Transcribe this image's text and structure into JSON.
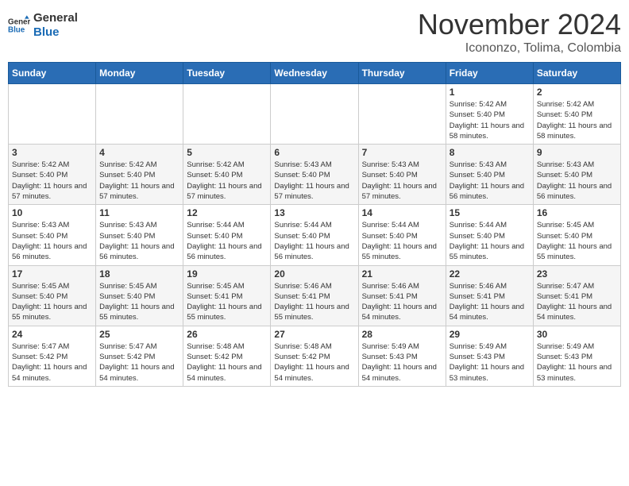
{
  "header": {
    "logo_general": "General",
    "logo_blue": "Blue",
    "month_title": "November 2024",
    "location": "Icononzo, Tolima, Colombia"
  },
  "weekdays": [
    "Sunday",
    "Monday",
    "Tuesday",
    "Wednesday",
    "Thursday",
    "Friday",
    "Saturday"
  ],
  "weeks": [
    [
      {
        "day": "",
        "detail": ""
      },
      {
        "day": "",
        "detail": ""
      },
      {
        "day": "",
        "detail": ""
      },
      {
        "day": "",
        "detail": ""
      },
      {
        "day": "",
        "detail": ""
      },
      {
        "day": "1",
        "detail": "Sunrise: 5:42 AM\nSunset: 5:40 PM\nDaylight: 11 hours and 58 minutes."
      },
      {
        "day": "2",
        "detail": "Sunrise: 5:42 AM\nSunset: 5:40 PM\nDaylight: 11 hours and 58 minutes."
      }
    ],
    [
      {
        "day": "3",
        "detail": "Sunrise: 5:42 AM\nSunset: 5:40 PM\nDaylight: 11 hours and 57 minutes."
      },
      {
        "day": "4",
        "detail": "Sunrise: 5:42 AM\nSunset: 5:40 PM\nDaylight: 11 hours and 57 minutes."
      },
      {
        "day": "5",
        "detail": "Sunrise: 5:42 AM\nSunset: 5:40 PM\nDaylight: 11 hours and 57 minutes."
      },
      {
        "day": "6",
        "detail": "Sunrise: 5:43 AM\nSunset: 5:40 PM\nDaylight: 11 hours and 57 minutes."
      },
      {
        "day": "7",
        "detail": "Sunrise: 5:43 AM\nSunset: 5:40 PM\nDaylight: 11 hours and 57 minutes."
      },
      {
        "day": "8",
        "detail": "Sunrise: 5:43 AM\nSunset: 5:40 PM\nDaylight: 11 hours and 56 minutes."
      },
      {
        "day": "9",
        "detail": "Sunrise: 5:43 AM\nSunset: 5:40 PM\nDaylight: 11 hours and 56 minutes."
      }
    ],
    [
      {
        "day": "10",
        "detail": "Sunrise: 5:43 AM\nSunset: 5:40 PM\nDaylight: 11 hours and 56 minutes."
      },
      {
        "day": "11",
        "detail": "Sunrise: 5:43 AM\nSunset: 5:40 PM\nDaylight: 11 hours and 56 minutes."
      },
      {
        "day": "12",
        "detail": "Sunrise: 5:44 AM\nSunset: 5:40 PM\nDaylight: 11 hours and 56 minutes."
      },
      {
        "day": "13",
        "detail": "Sunrise: 5:44 AM\nSunset: 5:40 PM\nDaylight: 11 hours and 56 minutes."
      },
      {
        "day": "14",
        "detail": "Sunrise: 5:44 AM\nSunset: 5:40 PM\nDaylight: 11 hours and 55 minutes."
      },
      {
        "day": "15",
        "detail": "Sunrise: 5:44 AM\nSunset: 5:40 PM\nDaylight: 11 hours and 55 minutes."
      },
      {
        "day": "16",
        "detail": "Sunrise: 5:45 AM\nSunset: 5:40 PM\nDaylight: 11 hours and 55 minutes."
      }
    ],
    [
      {
        "day": "17",
        "detail": "Sunrise: 5:45 AM\nSunset: 5:40 PM\nDaylight: 11 hours and 55 minutes."
      },
      {
        "day": "18",
        "detail": "Sunrise: 5:45 AM\nSunset: 5:40 PM\nDaylight: 11 hours and 55 minutes."
      },
      {
        "day": "19",
        "detail": "Sunrise: 5:45 AM\nSunset: 5:41 PM\nDaylight: 11 hours and 55 minutes."
      },
      {
        "day": "20",
        "detail": "Sunrise: 5:46 AM\nSunset: 5:41 PM\nDaylight: 11 hours and 55 minutes."
      },
      {
        "day": "21",
        "detail": "Sunrise: 5:46 AM\nSunset: 5:41 PM\nDaylight: 11 hours and 54 minutes."
      },
      {
        "day": "22",
        "detail": "Sunrise: 5:46 AM\nSunset: 5:41 PM\nDaylight: 11 hours and 54 minutes."
      },
      {
        "day": "23",
        "detail": "Sunrise: 5:47 AM\nSunset: 5:41 PM\nDaylight: 11 hours and 54 minutes."
      }
    ],
    [
      {
        "day": "24",
        "detail": "Sunrise: 5:47 AM\nSunset: 5:42 PM\nDaylight: 11 hours and 54 minutes."
      },
      {
        "day": "25",
        "detail": "Sunrise: 5:47 AM\nSunset: 5:42 PM\nDaylight: 11 hours and 54 minutes."
      },
      {
        "day": "26",
        "detail": "Sunrise: 5:48 AM\nSunset: 5:42 PM\nDaylight: 11 hours and 54 minutes."
      },
      {
        "day": "27",
        "detail": "Sunrise: 5:48 AM\nSunset: 5:42 PM\nDaylight: 11 hours and 54 minutes."
      },
      {
        "day": "28",
        "detail": "Sunrise: 5:49 AM\nSunset: 5:43 PM\nDaylight: 11 hours and 54 minutes."
      },
      {
        "day": "29",
        "detail": "Sunrise: 5:49 AM\nSunset: 5:43 PM\nDaylight: 11 hours and 53 minutes."
      },
      {
        "day": "30",
        "detail": "Sunrise: 5:49 AM\nSunset: 5:43 PM\nDaylight: 11 hours and 53 minutes."
      }
    ]
  ]
}
